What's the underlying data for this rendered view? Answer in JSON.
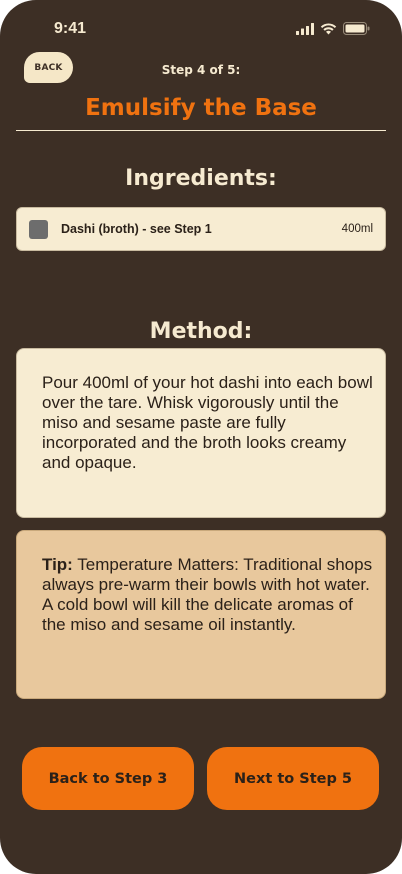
{
  "status_bar": {
    "time": "9:41"
  },
  "header": {
    "back_label": "BACK",
    "step_counter": "Step 4 of 5:",
    "title": "Emulsify the Base"
  },
  "ingredients": {
    "heading": "Ingredients:",
    "items": [
      {
        "name": "Dashi (broth) - see Step 1",
        "quantity": "400ml",
        "checked": false
      }
    ]
  },
  "method": {
    "heading": "Method:",
    "text": "Pour 400ml of your hot dashi into each bowl over the tare. Whisk vigorously until the miso and sesame paste are fully incorporated and the broth looks creamy and opaque."
  },
  "tip": {
    "label": "Tip:",
    "text": "Temperature Matters: Traditional shops always pre-warm their bowls with hot water. A cold bowl will kill the delicate aromas of the miso and sesame oil instantly."
  },
  "navigation": {
    "prev_label": "Back to Step 3",
    "next_label": "Next to Step 5"
  },
  "colors": {
    "background": "#3d2f25",
    "accent": "#f07210",
    "card": "#f7ecd2",
    "tip_card": "#e8c89d",
    "text_light": "#f6ead0"
  },
  "icons": [
    "signal-icon",
    "wifi-icon",
    "battery-icon"
  ]
}
